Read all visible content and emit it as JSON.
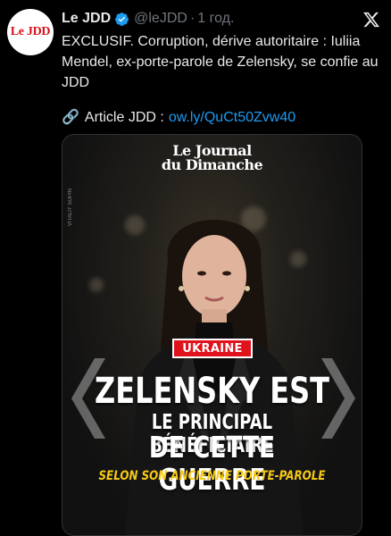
{
  "tweet": {
    "author_name": "Le JDD",
    "handle": "@leJDD",
    "separator": "·",
    "time": "1 год.",
    "avatar_text": "Le JDD",
    "text": "EXCLUSIF. Corruption, dérive autoritaire : Iuliia Mendel, ex-porte-parole de Zelensky, se confie au JDD",
    "link_prefix": "Article JDD :",
    "link_url": "ow.ly/QuCt50Zvw40"
  },
  "media": {
    "masthead_line1": "Le Journal",
    "masthead_line2": "du Dimanche",
    "photo_credit": "VITALIY SOPIN",
    "badge": "UKRAINE",
    "headline_line1": "ZELENSKY EST",
    "headline_line2": "LE PRINCIPAL BÉNÉFICIAIRE",
    "headline_line3": "DE CETTE GUERRE",
    "subline": "SELON SON ANCIENNE PORTE-PAROLE"
  },
  "colors": {
    "background": "#000000",
    "link": "#1d9bf0",
    "badge_red": "#e0121c",
    "subline_yellow": "#f6c915",
    "verified_blue": "#1d9bf0"
  },
  "icons": {
    "verified": "verified-badge-icon",
    "platform": "x-logo-icon",
    "link": "link-chain-icon"
  }
}
